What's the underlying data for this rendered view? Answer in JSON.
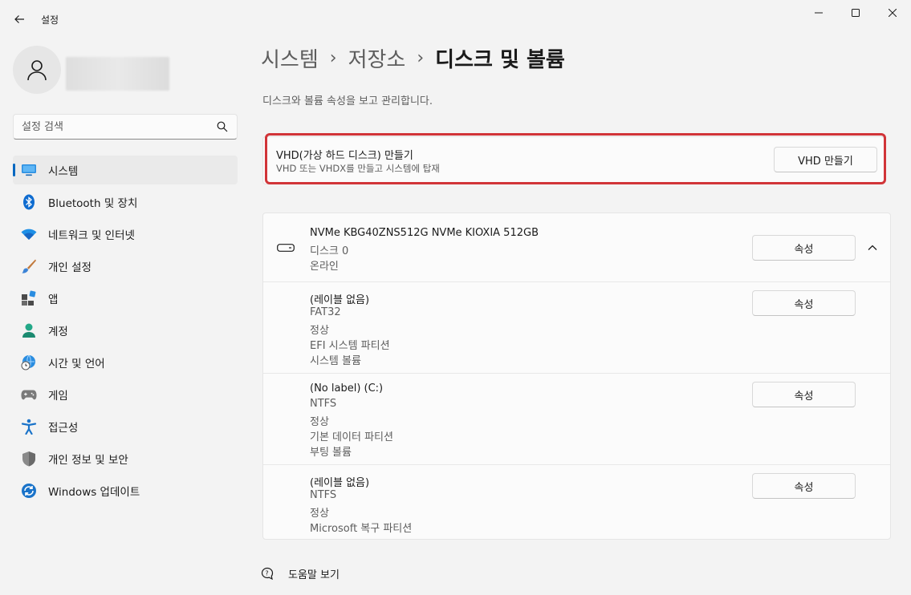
{
  "window": {
    "title": "설정"
  },
  "search": {
    "placeholder": "설정 검색"
  },
  "sidebar": {
    "items": [
      {
        "label": "시스템",
        "icon": "monitor-icon",
        "selected": true
      },
      {
        "label": "Bluetooth 및 장치",
        "icon": "bluetooth-icon",
        "selected": false
      },
      {
        "label": "네트워크 및 인터넷",
        "icon": "wifi-icon",
        "selected": false
      },
      {
        "label": "개인 설정",
        "icon": "paintbrush-icon",
        "selected": false
      },
      {
        "label": "앱",
        "icon": "apps-icon",
        "selected": false
      },
      {
        "label": "계정",
        "icon": "person-icon",
        "selected": false
      },
      {
        "label": "시간 및 언어",
        "icon": "globe-clock-icon",
        "selected": false
      },
      {
        "label": "게임",
        "icon": "gamepad-icon",
        "selected": false
      },
      {
        "label": "접근성",
        "icon": "accessibility-icon",
        "selected": false
      },
      {
        "label": "개인 정보 및 보안",
        "icon": "shield-icon",
        "selected": false
      },
      {
        "label": "Windows 업데이트",
        "icon": "update-icon",
        "selected": false
      }
    ]
  },
  "breadcrumb": {
    "items": [
      "시스템",
      "저장소",
      "디스크 및 볼륨"
    ],
    "separator": "›"
  },
  "page": {
    "description": "디스크와 볼륨 속성을 보고 관리합니다."
  },
  "vhd": {
    "title": "VHD(가상 하드 디스크) 만들기",
    "subtitle": "VHD 또는 VHDX를 만들고 시스템에 탑재",
    "button": "VHD 만들기"
  },
  "disk": {
    "name": "NVMe KBG40ZNS512G NVMe KIOXIA 512GB",
    "number": "디스크 0",
    "status": "온라인",
    "button": "속성",
    "volumes": [
      {
        "lines": [
          "(레이블 없음)",
          "FAT32",
          "정상",
          "EFI 시스템 파티션",
          "시스템 볼륨"
        ],
        "button": "속성"
      },
      {
        "lines": [
          "(No label) (C:)",
          "NTFS",
          "정상",
          "기본 데이터 파티션",
          "부팅 볼륨"
        ],
        "button": "속성"
      },
      {
        "lines": [
          "(레이블 없음)",
          "NTFS",
          "정상",
          "Microsoft 복구 파티션"
        ],
        "button": "속성"
      }
    ]
  },
  "help": {
    "label": "도움말 보기"
  },
  "colors": {
    "accent": "#0067c0",
    "highlight": "#d13438",
    "background": "#f3f3f3",
    "card": "#fbfbfb"
  }
}
